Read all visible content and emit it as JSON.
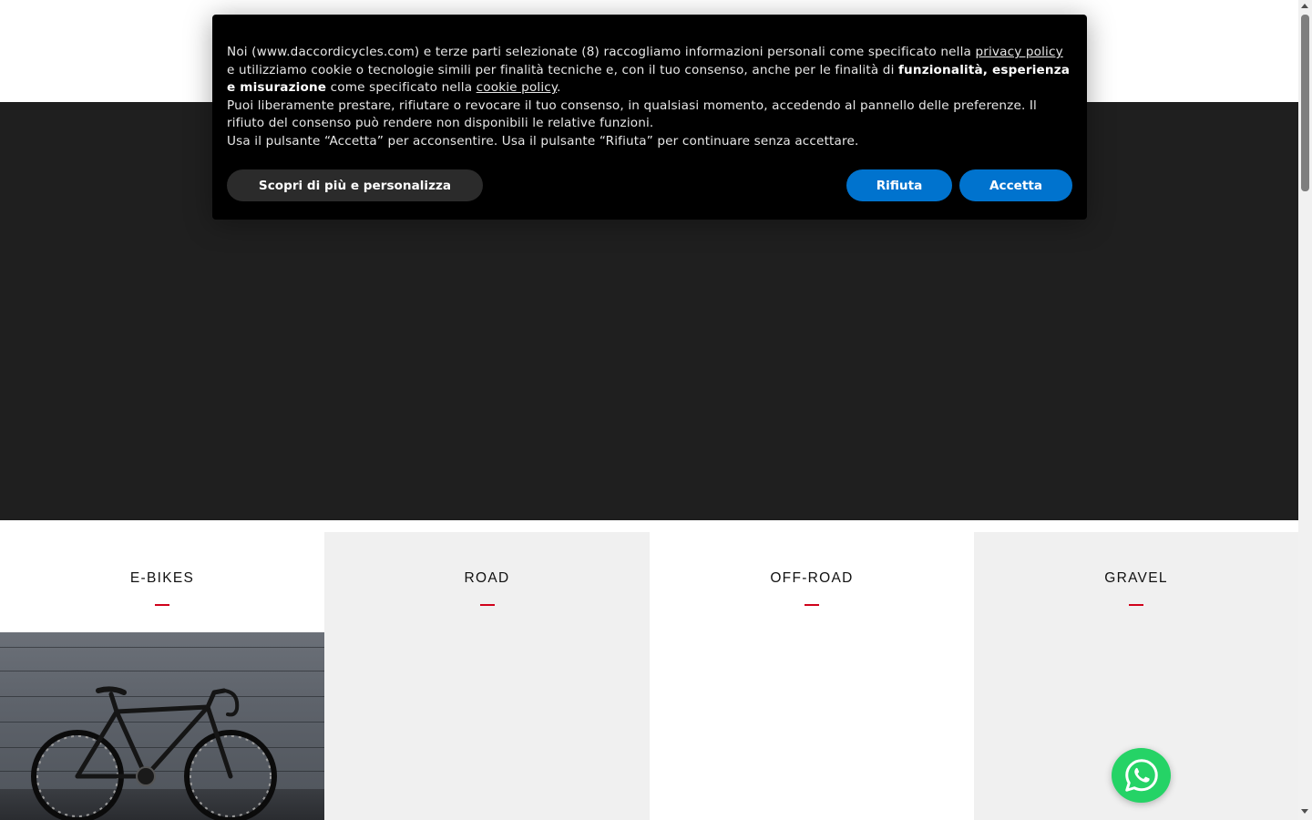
{
  "cookie_banner": {
    "paragraphs": [
      {
        "segments": [
          {
            "text": "Noi (www.daccordicycles.com) e terze parti selezionate (8) raccogliamo informazioni personali come specificato nella ",
            "style": "normal"
          },
          {
            "text": "privacy policy",
            "style": "link"
          },
          {
            "text": " e utilizziamo cookie o tecnologie simili per finalità tecniche e, con il tuo consenso, anche per le finalità di ",
            "style": "normal"
          },
          {
            "text": "funzionalità, esperienza e misurazione",
            "style": "bold"
          },
          {
            "text": " come specificato nella ",
            "style": "normal"
          },
          {
            "text": "cookie policy",
            "style": "link"
          },
          {
            "text": ".",
            "style": "normal"
          }
        ]
      },
      {
        "segments": [
          {
            "text": "Puoi liberamente prestare, rifiutare o revocare il tuo consenso, in qualsiasi momento, accedendo al pannello delle preferenze. Il rifiuto del consenso può rendere non disponibili le relative funzioni.",
            "style": "normal"
          }
        ]
      },
      {
        "segments": [
          {
            "text": "Usa il pulsante “Accetta” per acconsentire. Usa il pulsante “Rifiuta” per continuare senza accettare.",
            "style": "normal"
          }
        ]
      }
    ],
    "learn_more_label": "Scopri di più e personalizza",
    "reject_label": "Rifiuta",
    "accept_label": "Accetta"
  },
  "categories": [
    {
      "label": "E-BIKES",
      "alternate_bg": false,
      "has_image": true,
      "image_icon": "road-bike-photo"
    },
    {
      "label": "ROAD",
      "alternate_bg": true,
      "has_image": false
    },
    {
      "label": "OFF-ROAD",
      "alternate_bg": false,
      "has_image": false
    },
    {
      "label": "GRAVEL",
      "alternate_bg": true,
      "has_image": false
    }
  ],
  "whatsapp": {
    "icon": "whatsapp-icon",
    "color": "#25d366"
  },
  "colors": {
    "hero_bg": "#1f1f1f",
    "banner_bg": "#000000",
    "button_blue": "#0073ce",
    "button_dark": "#2b2b2b",
    "accent_red": "#d0021b",
    "alt_panel_bg": "#f0f0f0"
  }
}
